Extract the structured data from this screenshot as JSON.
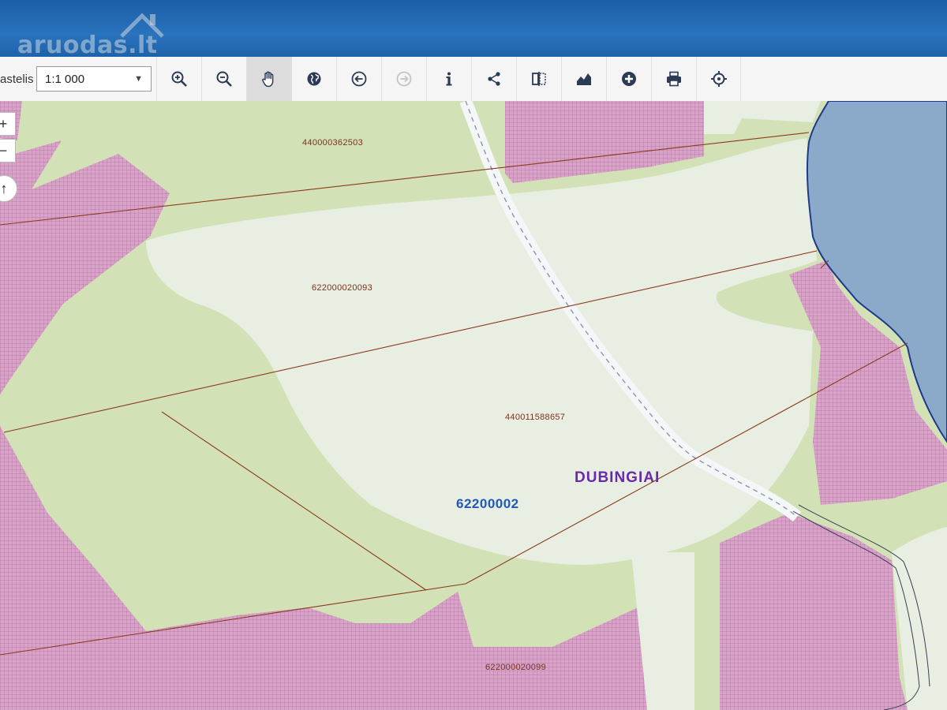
{
  "watermark": "aruodas.lt",
  "toolbar": {
    "scale_label": "astelis:",
    "scale_value": "1:1 000",
    "tools": [
      {
        "name": "zoom-in-icon",
        "active": false
      },
      {
        "name": "zoom-out-icon",
        "active": false
      },
      {
        "name": "pan-hand-icon",
        "active": true
      },
      {
        "name": "globe-icon",
        "active": false
      },
      {
        "name": "back-arrow-icon",
        "active": false
      },
      {
        "name": "forward-arrow-icon",
        "active": false,
        "disabled": true
      },
      {
        "name": "info-icon",
        "active": false
      },
      {
        "name": "share-icon",
        "active": false
      },
      {
        "name": "compare-icon",
        "active": false
      },
      {
        "name": "profile-chart-icon",
        "active": false
      },
      {
        "name": "add-icon",
        "active": false
      },
      {
        "name": "print-icon",
        "active": false
      },
      {
        "name": "locate-icon",
        "active": false
      }
    ]
  },
  "map_controls": {
    "zoom_in": "+",
    "zoom_out": "−",
    "north": "↑"
  },
  "map": {
    "parcels": [
      {
        "id": "440000362503"
      },
      {
        "id": "622000020093"
      },
      {
        "id": "440011588657"
      },
      {
        "id": "622000020099"
      }
    ],
    "cadastral_block": "62200002",
    "place_name": "DUBINGIAI"
  },
  "colors": {
    "toolbar_bg": "#f5f5f5",
    "header_blue": "#2a73bd",
    "forest_green": "#d3e2b8",
    "built_pink": "#d5a0c6",
    "open_land": "#e9eee2",
    "water_blue": "#8aa8c8",
    "parcel_line": "#8a3a1c",
    "place_label": "#6a2aa8",
    "block_label": "#2358b8"
  }
}
